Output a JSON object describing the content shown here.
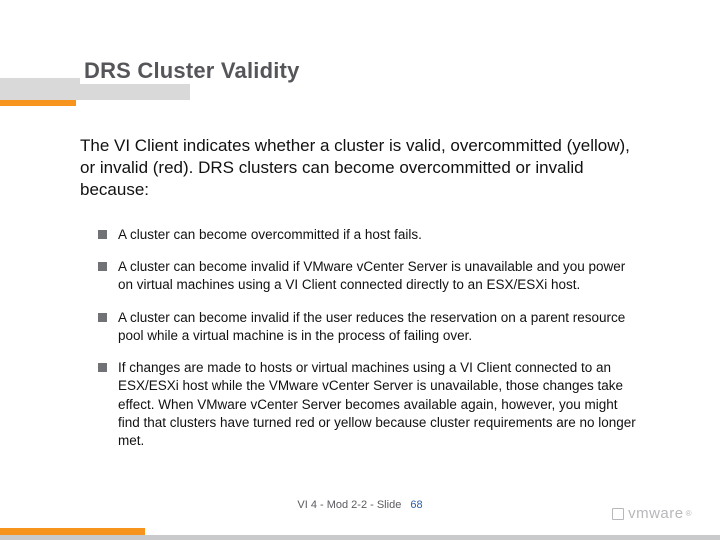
{
  "title": "DRS Cluster Validity",
  "intro": "The VI Client indicates whether a cluster is valid, overcommitted (yellow), or invalid (red). DRS clusters can become overcommitted or invalid because:",
  "bullets": [
    "A cluster can become overcommitted if a host fails.",
    "A cluster can become invalid if VMware vCenter Server is unavailable and you power on virtual machines using a VI Client connected directly to an ESX/ESXi host.",
    "A cluster can become invalid if the user reduces the reservation on a parent resource pool while a virtual machine is in the process of failing over.",
    "If changes are made to hosts or virtual machines using a VI Client connected to an ESX/ESXi host while the VMware vCenter Server is unavailable, those changes take effect. When VMware vCenter Server becomes available again, however, you might find that clusters have turned red or yellow because cluster requirements are no longer met."
  ],
  "footer": {
    "label": "VI 4 - Mod 2-2 - Slide",
    "num": "68"
  },
  "brand": {
    "name": "vmware",
    "tm": "®"
  }
}
